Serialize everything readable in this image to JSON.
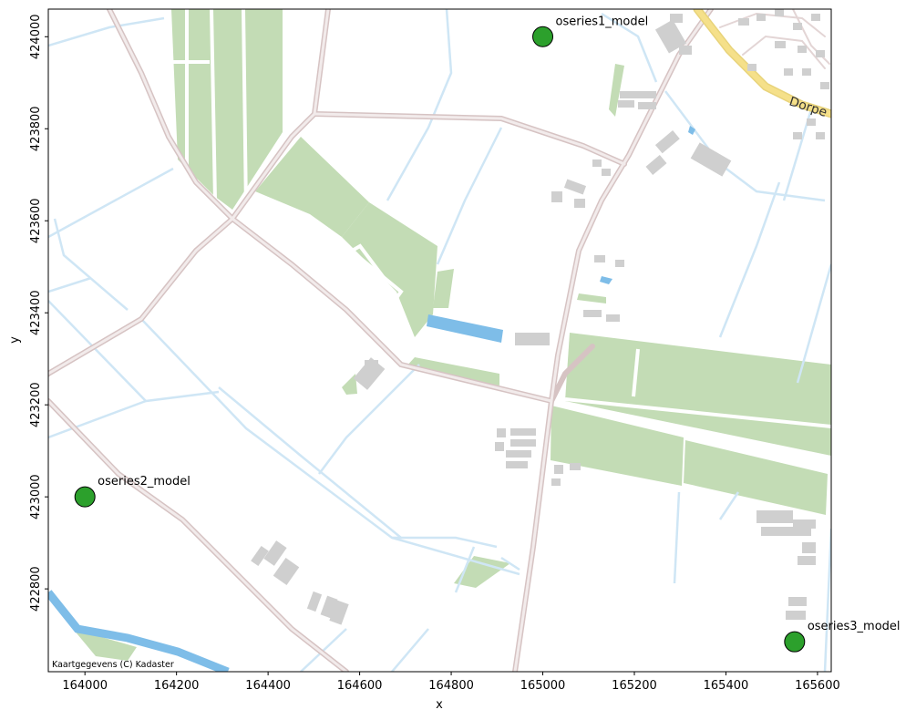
{
  "chart_data": {
    "type": "scatter",
    "title": "",
    "xlabel": "x",
    "ylabel": "y",
    "xlim": [
      163920,
      165630
    ],
    "ylim": [
      422620,
      424060
    ],
    "x_ticks": [
      164000,
      164200,
      164400,
      164600,
      164800,
      165000,
      165200,
      165400,
      165600
    ],
    "y_ticks": [
      422800,
      423000,
      423200,
      423400,
      423600,
      423800,
      424000
    ],
    "x_tick_labels": [
      "164000",
      "164200",
      "164400",
      "164600",
      "164800",
      "165000",
      "165200",
      "165400",
      "165600"
    ],
    "y_tick_labels": [
      "422800",
      "423000",
      "423200",
      "423400",
      "423600",
      "423800",
      "424000"
    ],
    "grid": false,
    "marker_color": "#2ca02c",
    "points": [
      {
        "x": 165000,
        "y": 424000,
        "label": "oseries1_model"
      },
      {
        "x": 164000,
        "y": 423000,
        "label": "oseries2_model"
      },
      {
        "x": 165550,
        "y": 422685,
        "label": "oseries3_model"
      }
    ]
  },
  "basemap": {
    "attribution": "Kaartgegevens (C) Kadaster",
    "road_label": "Dorpe",
    "colors": {
      "water": "#7ebde8",
      "ditch": "#cfe6f5",
      "field": "#c3dcb5",
      "road": "#ecdcdc",
      "road_edge": "#d6c3c3",
      "building": "#cfcfcf",
      "highway": "#f5e08a"
    }
  }
}
